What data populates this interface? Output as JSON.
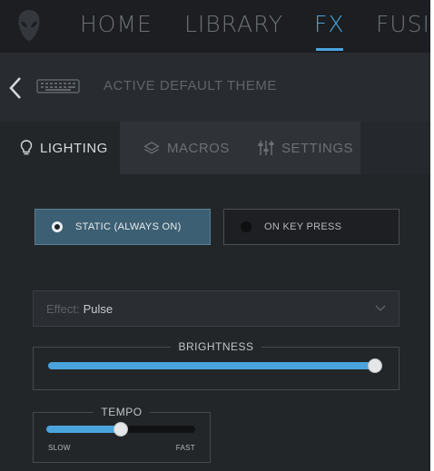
{
  "nav": {
    "items": [
      "HOME",
      "LIBRARY",
      "FX",
      "FUSI"
    ],
    "active": "FX"
  },
  "subheader": {
    "title": "ACTIVE DEFAULT THEME"
  },
  "tabs": {
    "lighting": "LIGHTING",
    "macros": "MACROS",
    "settings": "SETTINGS"
  },
  "lighting": {
    "mode_static": "STATIC (ALWAYS ON)",
    "mode_keypress": "ON KEY PRESS",
    "effect_label": "Effect:",
    "effect_value": "Pulse",
    "brightness": {
      "label": "BRIGHTNESS",
      "value_fraction": 0.99
    },
    "tempo": {
      "label": "TEMPO",
      "min_label": "SLOW",
      "max_label": "FAST",
      "value_fraction": 0.5
    }
  },
  "colors": {
    "accent": "#4aa3dc",
    "background": "#232629"
  },
  "icons": {
    "back": "chevron-left-icon",
    "keyboard": "keyboard-icon",
    "lighting": "lightbulb-icon",
    "macros": "layers-icon",
    "settings": "sliders-icon",
    "dropdown": "chevron-down-icon"
  }
}
